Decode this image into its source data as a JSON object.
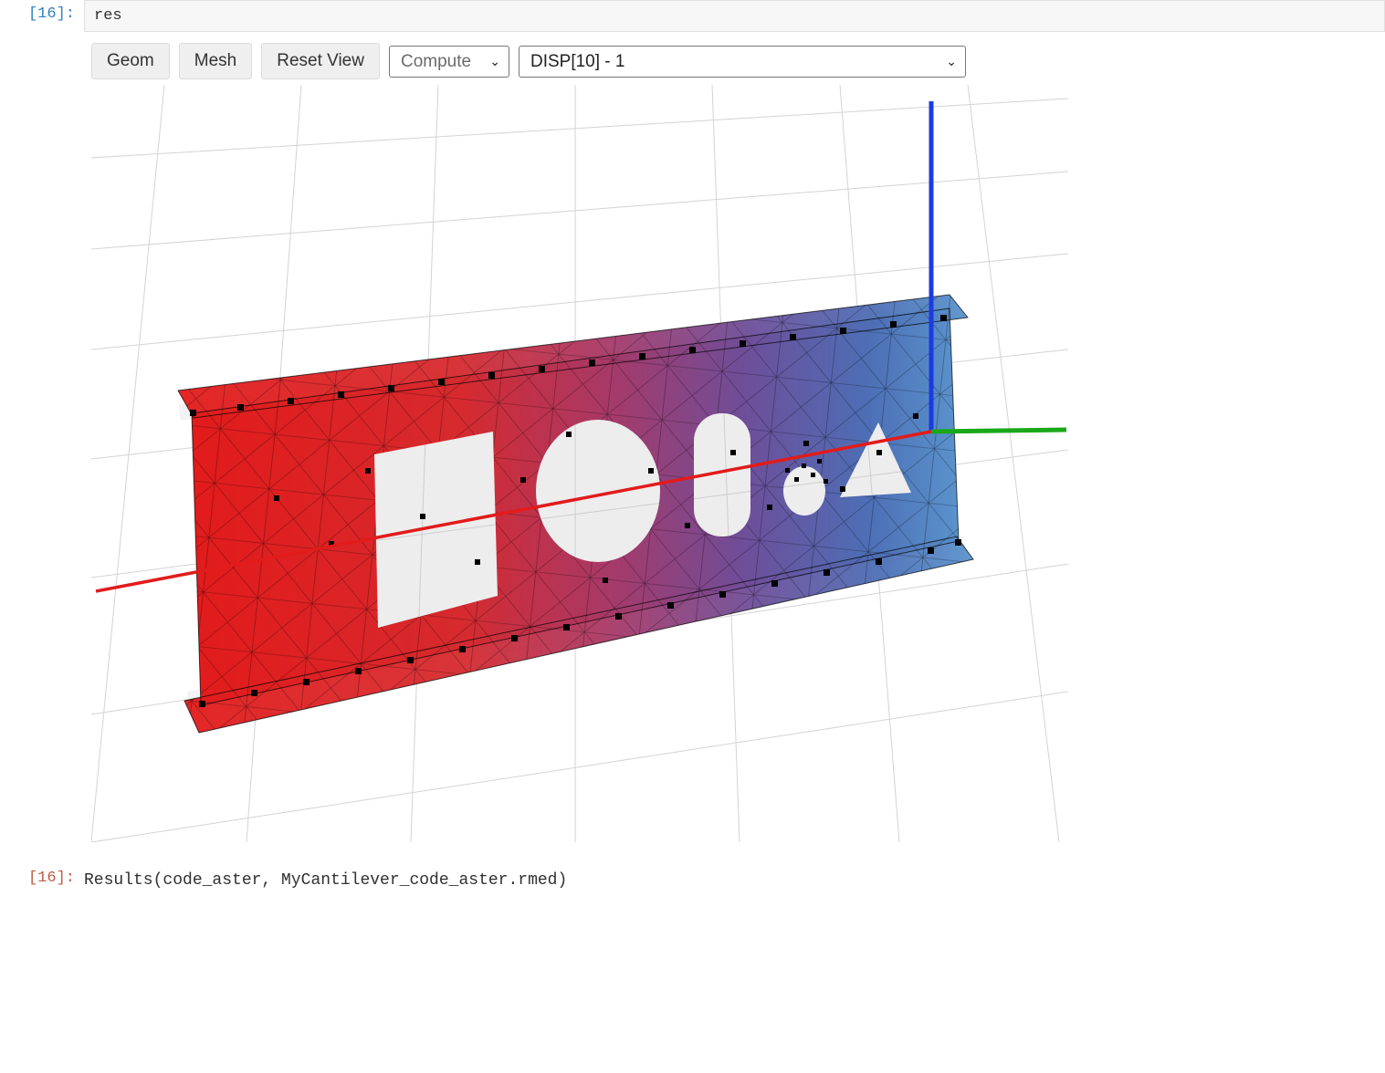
{
  "cell_in": {
    "prompt": "[16]:",
    "code": "res"
  },
  "toolbar": {
    "geom_button": "Geom",
    "mesh_button": "Mesh",
    "reset_button": "Reset View",
    "compute_select": "Compute",
    "field_select": "DISP[10] - 1"
  },
  "cell_out": {
    "prompt": "[16]:",
    "text": "Results(code_aster, MyCantilever_code_aster.rmed)"
  },
  "viz": {
    "axis_colors": {
      "x": "#e21b1b",
      "y": "#1aa81a",
      "z": "#1b3be2"
    },
    "gradient": {
      "left": "#e21b1b",
      "right": "#4a86c7"
    }
  }
}
